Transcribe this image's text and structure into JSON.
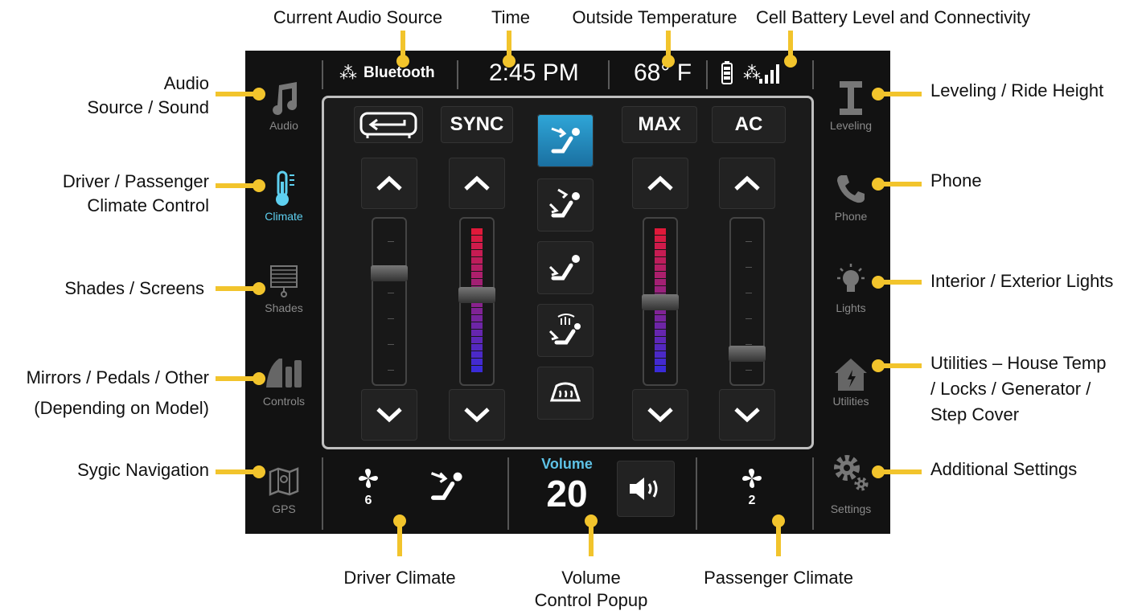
{
  "callouts": {
    "current_audio_source": "Current Audio Source",
    "time": "Time",
    "outside_temperature": "Outside Temperature",
    "cell_battery": "Cell Battery Level and Connectivity",
    "audio_l1": "Audio",
    "audio_l2": "Source / Sound",
    "climate_l1": "Driver / Passenger",
    "climate_l2": "Climate Control",
    "shades": "Shades / Screens",
    "mirrors_l1": "Mirrors / Pedals / Other",
    "mirrors_l2": "(Depending on Model)",
    "sygic": "Sygic Navigation",
    "leveling": "Leveling / Ride Height",
    "phone": "Phone",
    "lights": "Interior / Exterior Lights",
    "utilities_l1": "Utilities – House Temp",
    "utilities_l2": "/ Locks / Generator /",
    "utilities_l3": "Step Cover",
    "additional": "Additional Settings",
    "driver_climate": "Driver Climate",
    "volume_l1": "Volume",
    "volume_l2": "Control Popup",
    "passenger_climate": "Passenger Climate"
  },
  "left_nav": [
    {
      "label": "Audio",
      "icon": "music-note-icon"
    },
    {
      "label": "Climate",
      "icon": "thermometer-icon",
      "active": true
    },
    {
      "label": "Shades",
      "icon": "shade-icon"
    },
    {
      "label": "Controls",
      "icon": "mirror-pedal-icon"
    },
    {
      "label": "GPS",
      "icon": "map-icon"
    }
  ],
  "right_nav": [
    {
      "label": "Leveling",
      "icon": "leveling-icon"
    },
    {
      "label": "Phone",
      "icon": "phone-icon"
    },
    {
      "label": "Lights",
      "icon": "bulb-icon"
    },
    {
      "label": "Utilities",
      "icon": "house-icon"
    },
    {
      "label": "Settings",
      "icon": "gears-icon"
    }
  ],
  "status": {
    "audio_source": "Bluetooth",
    "time": "2:45 PM",
    "temperature": "68° F"
  },
  "climate": {
    "recirc_icon": "recirculate-icon",
    "sync_label": "SYNC",
    "max_label": "MAX",
    "ac_label": "AC",
    "modes": [
      "face-vent-icon",
      "face-floor-vent-icon",
      "floor-vent-icon",
      "defrost-floor-vent-icon",
      "defrost-icon"
    ],
    "active_mode": 0,
    "sliders": [
      {
        "name": "driver-fan",
        "level": 0.75,
        "colored": false
      },
      {
        "name": "driver-temp",
        "level": 0.6,
        "colored": true
      },
      {
        "name": "passenger-temp",
        "level": 0.55,
        "colored": true
      },
      {
        "name": "passenger-fan",
        "level": 0.2,
        "colored": false
      }
    ]
  },
  "bottom": {
    "driver_fan": "6",
    "volume_label": "Volume",
    "volume_value": "20",
    "passenger_fan": "2"
  },
  "colors": {
    "accent": "#f2c42c",
    "active": "#5ed0f0",
    "temp_hot": "#e0193a",
    "temp_cold": "#3a2bd8"
  }
}
